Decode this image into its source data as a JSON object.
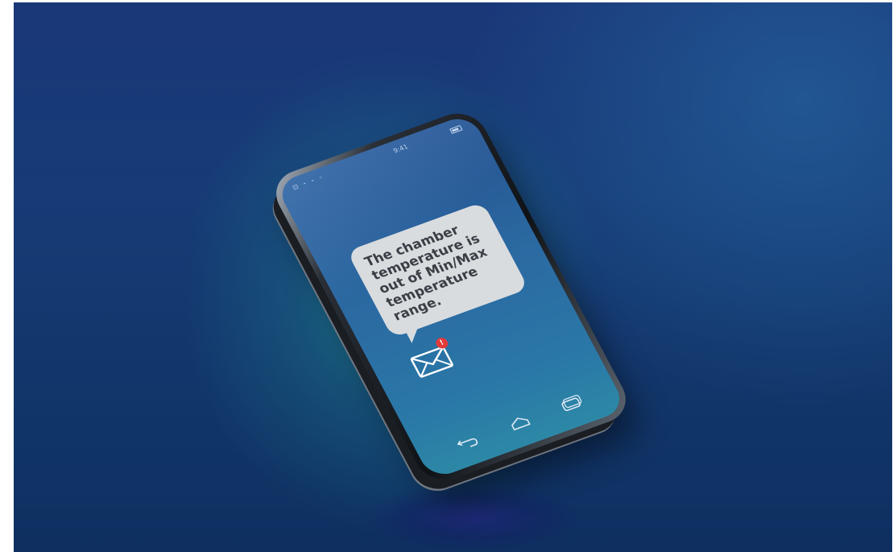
{
  "notification": {
    "message": "The chamber\ntemperature is\nout of Min/Max\ntemperature\nrange.",
    "badge": "!"
  },
  "status_bar": {
    "signal_text": "⊡ ⁃ ⁃ ◦",
    "time": "9:41"
  },
  "icons": {
    "envelope": "mail-icon",
    "back": "back-icon",
    "home": "home-icon",
    "recent": "recent-apps-icon"
  },
  "colors": {
    "background": "#173b76",
    "glow": "#28bea5",
    "bubble": "#d9dcdf",
    "bubble_text": "#3a3f46",
    "badge": "#e23a3a"
  }
}
